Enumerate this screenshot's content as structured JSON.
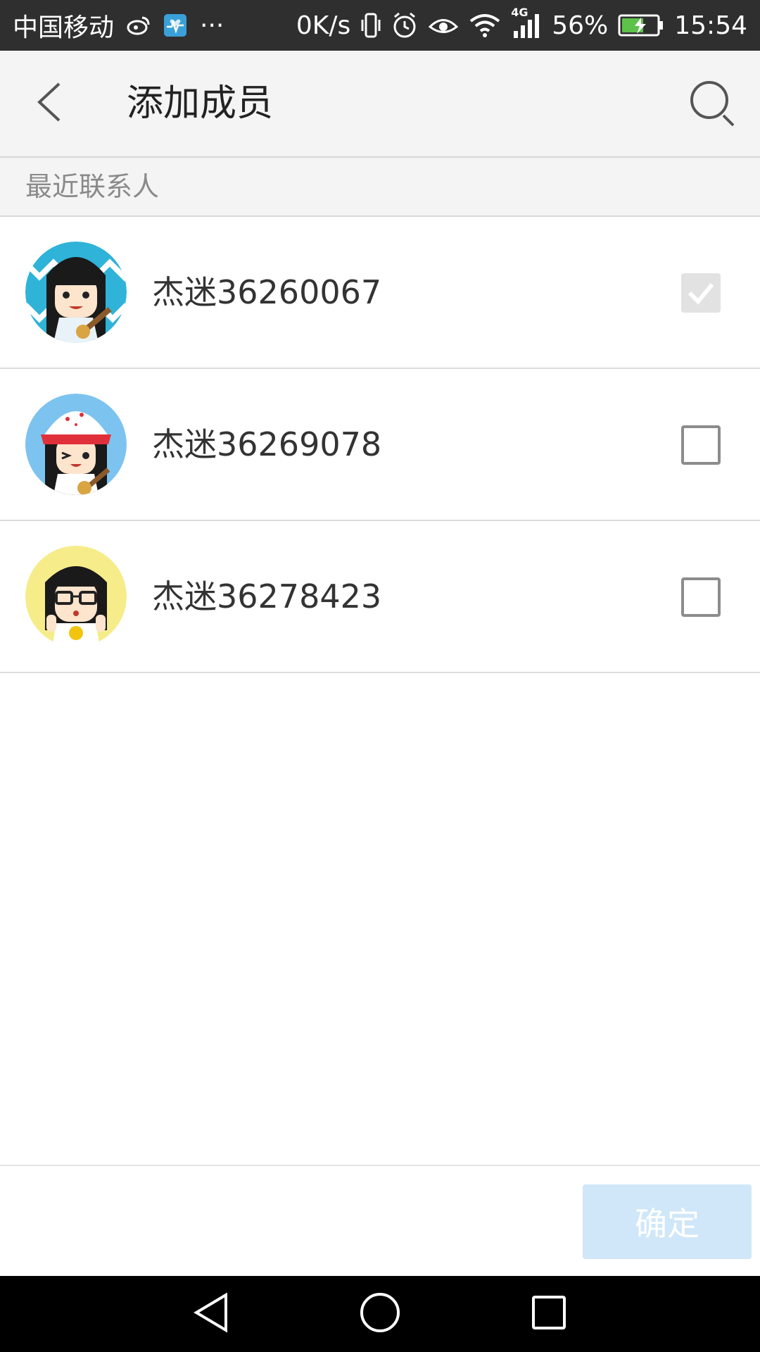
{
  "status_bar": {
    "carrier": "中国移动",
    "more": "···",
    "speed": "0K/s",
    "network": "4G",
    "battery": "56%",
    "time": "15:54"
  },
  "header": {
    "title": "添加成员",
    "back_icon": "back-arrow-icon",
    "search_icon": "search-icon"
  },
  "section": {
    "title": "最近联系人"
  },
  "contacts": [
    {
      "name": "杰迷36260067",
      "checked": true,
      "avatar_bg": "#2fb3d8"
    },
    {
      "name": "杰迷36269078",
      "checked": false,
      "avatar_bg": "#7cc3f0"
    },
    {
      "name": "杰迷36278423",
      "checked": false,
      "avatar_bg": "#f6ec8a"
    }
  ],
  "actions": {
    "confirm_label": "确定"
  },
  "colors": {
    "confirm_button": "#cfe7f8",
    "status_bar": "#2f2f2f",
    "app_bar": "#f4f4f4"
  }
}
